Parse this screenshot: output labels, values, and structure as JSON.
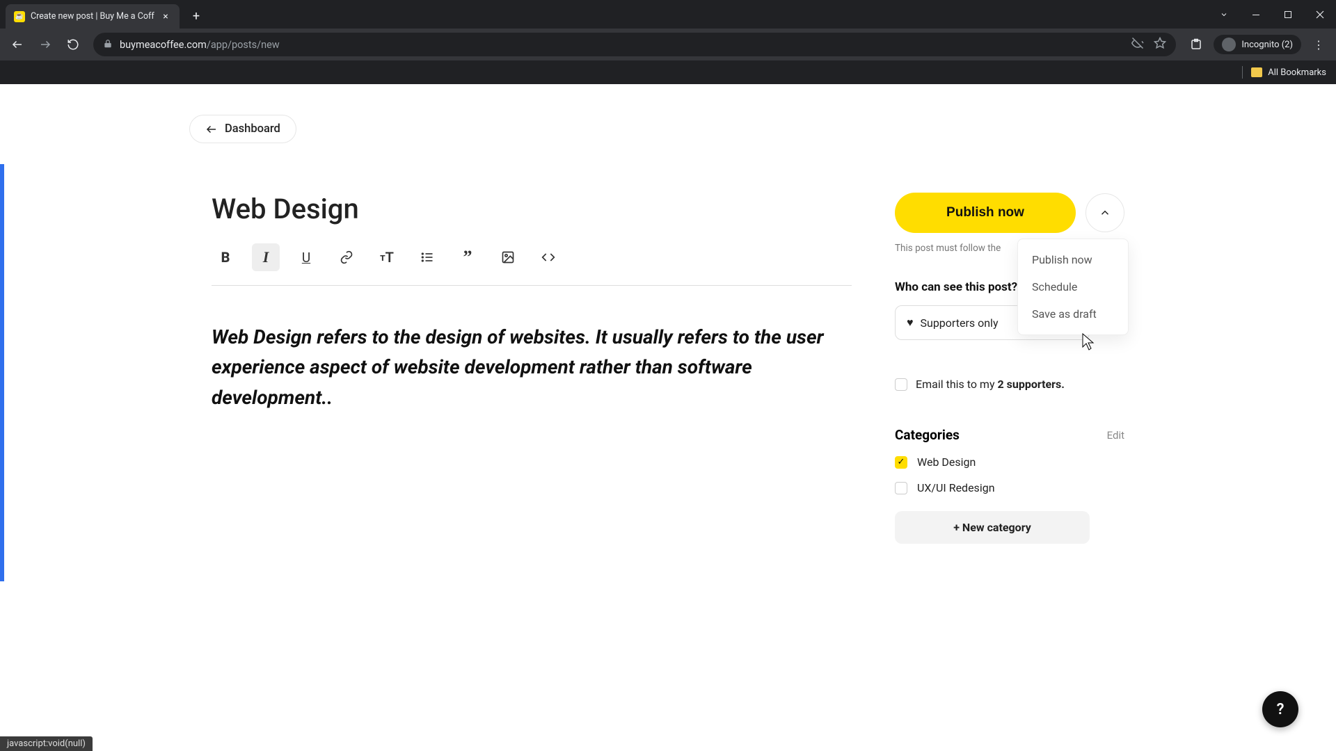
{
  "browser": {
    "tab_title": "Create new post | Buy Me a Coff",
    "url_host": "buymeacoffee.com",
    "url_path": "/app/posts/new",
    "incognito_label": "Incognito (2)",
    "bookmarks_label": "All Bookmarks"
  },
  "nav": {
    "back_label": "Dashboard"
  },
  "editor": {
    "title": "Web Design",
    "body": "Web Design refers to the design of websites. It usually refers to the user experience aspect of website development rather than software development.."
  },
  "publish": {
    "primary_label": "Publish now",
    "terms_prefix": "This post must follow the ",
    "menu": {
      "publish_now": "Publish now",
      "schedule": "Schedule",
      "save_draft": "Save as draft"
    }
  },
  "audience": {
    "heading": "Who can see this post?",
    "selected": "Supporters only"
  },
  "email": {
    "prefix": "Email this to my ",
    "count_bold": "2 supporters."
  },
  "categories": {
    "heading": "Categories",
    "edit_label": "Edit",
    "items": [
      {
        "label": "Web Design",
        "checked": true
      },
      {
        "label": "UX/UI Redesign",
        "checked": false
      }
    ],
    "new_label": "+ New category"
  },
  "status_text": "javascript:void(null)",
  "help": "?"
}
